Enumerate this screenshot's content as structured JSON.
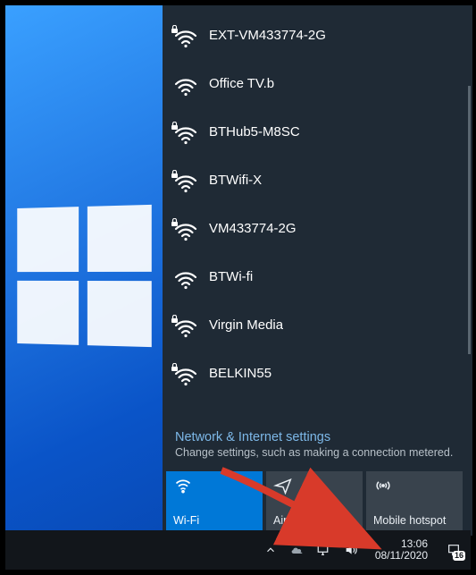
{
  "networks": [
    {
      "name": "EXT-VM433774-2G",
      "secured": true
    },
    {
      "name": "Office TV.b",
      "secured": false
    },
    {
      "name": "BTHub5-M8SC",
      "secured": true
    },
    {
      "name": "BTWifi-X",
      "secured": true
    },
    {
      "name": "VM433774-2G",
      "secured": true
    },
    {
      "name": "BTWi-fi",
      "secured": false
    },
    {
      "name": "Virgin Media",
      "secured": true
    },
    {
      "name": "BELKIN55",
      "secured": true
    }
  ],
  "settings": {
    "title": "Network & Internet settings",
    "subtitle": "Change settings, such as making a connection metered."
  },
  "tiles": {
    "wifi": {
      "label": "Wi-Fi",
      "active": true
    },
    "airplane": {
      "label": "Airplane mode",
      "active": false
    },
    "hotspot": {
      "label": "Mobile hotspot",
      "active": false
    }
  },
  "tray": {
    "time": "13:06",
    "date": "08/11/2020",
    "notif_count": "16"
  }
}
